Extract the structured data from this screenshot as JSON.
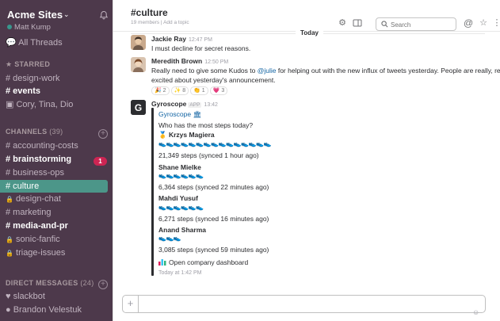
{
  "sidebar": {
    "team_name": "Acme Sites",
    "user_name": "Matt Kump",
    "all_threads": "All Threads",
    "starred_header": "STARRED",
    "starred": [
      {
        "label": "# design-work",
        "bold": false
      },
      {
        "label": "# events",
        "bold": true
      },
      {
        "label": "Cory, Tina, Dio",
        "bold": false
      }
    ],
    "channels_header": "CHANNELS",
    "channels_count": "(39)",
    "channels": [
      {
        "label": "# accounting-costs"
      },
      {
        "label": "# brainstorming",
        "badge": "1"
      },
      {
        "label": "# business-ops"
      },
      {
        "label": "# culture"
      },
      {
        "label": "design-chat"
      },
      {
        "label": "# marketing"
      },
      {
        "label": "# media-and-pr"
      },
      {
        "label": "sonic-fanfic"
      },
      {
        "label": "triage-issues"
      }
    ],
    "dm_header": "DIRECT MESSAGES",
    "dm_count": "(24)",
    "dms": [
      {
        "label": "slackbot"
      },
      {
        "label": "Brandon Velestuk"
      }
    ]
  },
  "channel": {
    "title": "#culture",
    "members": "19 members",
    "add_topic": "Add a topic"
  },
  "search": {
    "placeholder": "Search"
  },
  "divider": {
    "label": "Today"
  },
  "messages": [
    {
      "author": "Jackie Ray",
      "time": "12:47 PM",
      "text": "I must decline for secret reasons."
    },
    {
      "author": "Meredith Brown",
      "time": "12:50 PM",
      "text_1": "Really need to give some Kudos to ",
      "mention": "@julie",
      "text_2": " for helping out with the new influx of tweets yesterday. People are really, really",
      "text_3": "excited about yesterday's announcement.",
      "reactions": [
        "🎉 2",
        "✨ 8",
        "👏 1",
        "💗 3"
      ]
    }
  ],
  "bot": {
    "author": "Gyroscope",
    "app_tag": "APP",
    "time": "13:42",
    "attach_title": "Gyroscope",
    "question": "Who has the most steps today?",
    "entries": [
      {
        "name": "Krzys Magiera",
        "shoes": "👟👟👟👟👟👟👟👟👟👟👟👟👟👟👟",
        "steps": "21,349 steps (synced 1 hour ago)"
      },
      {
        "name": "Shane Mielke",
        "shoes": "👟👟👟👟👟👟",
        "steps": "6,364 steps (synced 22 minutes ago)"
      },
      {
        "name": "Mahdi Yusuf",
        "shoes": "👟👟👟👟👟👟",
        "steps": "6,271 steps (synced 16 minutes ago)"
      },
      {
        "name": "Anand Sharma",
        "shoes": "👟👟👟",
        "steps": "3,085 steps (synced 59 minutes ago)"
      }
    ],
    "dashboard_link": "Open company dashboard",
    "footer_time": "Today at 1:42 PM"
  },
  "composer": {
    "placeholder": ""
  },
  "colors": {
    "sidebar_bg": "#4d394b",
    "active_channel": "#4c9689",
    "badge": "#cd2553",
    "link": "#1264a3"
  }
}
